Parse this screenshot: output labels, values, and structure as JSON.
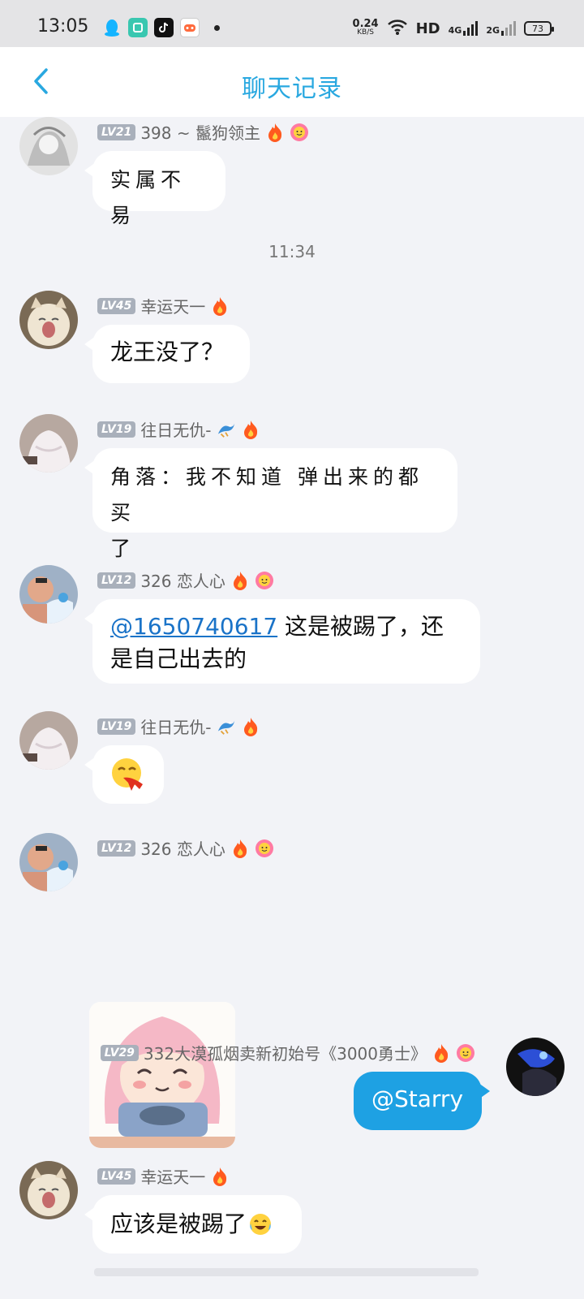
{
  "status_bar": {
    "time": "13:05",
    "net_speed_value": "0.24",
    "net_speed_unit": "KB/S",
    "hd_label": "HD",
    "sim1_label": "4G",
    "sim2_label": "2G",
    "battery": "73"
  },
  "header": {
    "title": "聊天记录"
  },
  "timestamp": "11:34",
  "messages": [
    {
      "level": "LV21",
      "sender": "398 ~ 鬣狗领主",
      "text": "实属不易"
    },
    {
      "level": "LV45",
      "sender": "幸运天一",
      "text": "龙王没了？"
    },
    {
      "level": "LV19",
      "sender": "往日无仇-",
      "line1": "角落：我不知道 弹出来的都买",
      "line2": "了"
    },
    {
      "level": "LV12",
      "sender": "326 恋人心",
      "mention": "@1650740617",
      "text_after_mention": " 这是被踢了，还",
      "line2": "是自己出去的"
    },
    {
      "level": "LV19",
      "sender": "往日无仇-",
      "emoji": "呕吐表情"
    },
    {
      "level": "LV12",
      "sender": "326 恋人心",
      "image": "anime-girl-sticker"
    },
    {
      "level": "LV29",
      "sender": "332大漠孤烟卖新初始号《3000勇士》",
      "text": "@Starry"
    },
    {
      "level": "LV45",
      "sender": "幸运天一",
      "text": "应该是被踢了"
    }
  ],
  "colors": {
    "accent": "#29a8e0",
    "self_bubble": "#1ea1e3",
    "level_badge": "#a9b0bb",
    "background": "#f2f3f7"
  }
}
